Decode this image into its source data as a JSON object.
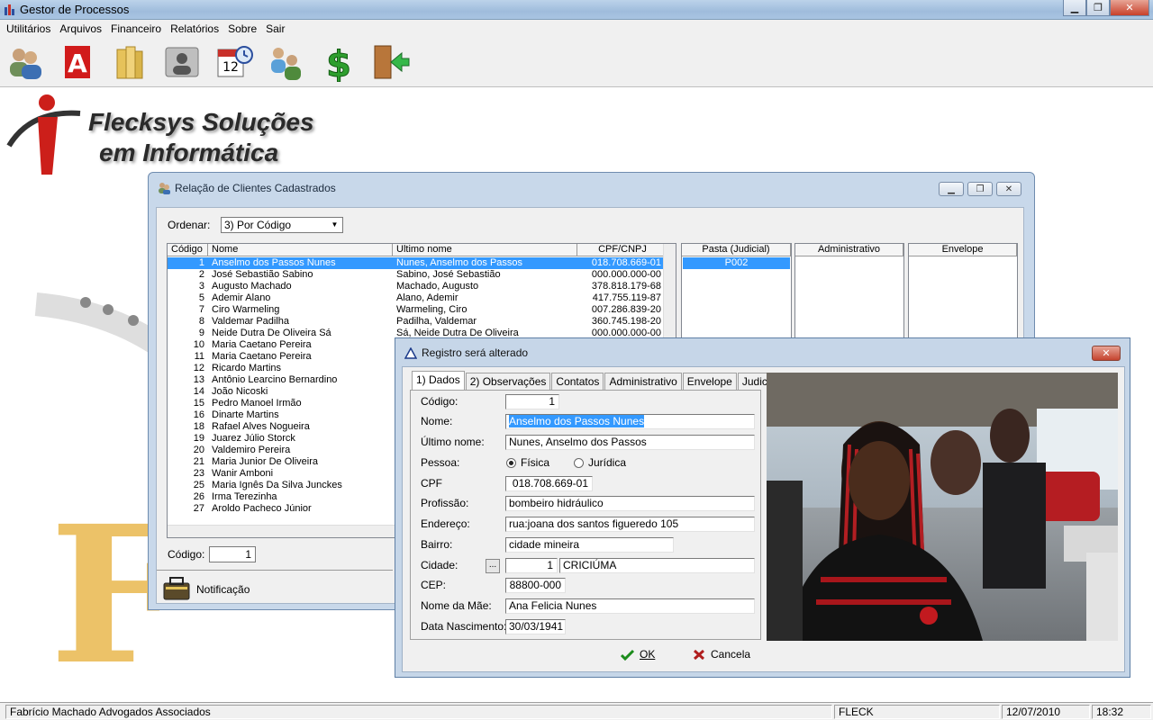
{
  "window": {
    "title": "Gestor de Processos"
  },
  "menu": [
    "Utilitários",
    "Arquivos",
    "Financeiro",
    "Relatórios",
    "Sobre",
    "Sair"
  ],
  "toolbar_icons": [
    "clients-icon",
    "acrobat-icon",
    "folders-icon",
    "contact-card-icon",
    "calendar-clock-icon",
    "users-icon",
    "dollar-icon",
    "exit-door-icon"
  ],
  "logo": {
    "line1": "Flecksys Soluções",
    "line2": "em Informática"
  },
  "clients": {
    "title": "Relação de Clientes Cadastrados",
    "order_label": "Ordenar:",
    "order_value": "3) Por Código",
    "columns": [
      "Código",
      "Nome",
      "Ultimo nome",
      "CPF/CNPJ"
    ],
    "rows": [
      [
        "1",
        "Anselmo dos Passos Nunes",
        "Nunes,  Anselmo dos Passos",
        "018.708.669-01"
      ],
      [
        "2",
        "José Sebastião Sabino",
        "Sabino,  José Sebastião",
        "000.000.000-00"
      ],
      [
        "3",
        "Augusto Machado",
        "Machado,  Augusto",
        "378.818.179-68"
      ],
      [
        "5",
        "Ademir Alano",
        "Alano,  Ademir",
        "417.755.119-87"
      ],
      [
        "7",
        "Ciro Warmeling",
        "Warmeling,  Ciro",
        "007.286.839-20"
      ],
      [
        "8",
        "Valdemar Padilha",
        "Padilha,  Valdemar",
        "360.745.198-20"
      ],
      [
        "9",
        "Neide Dutra De Oliveira Sá",
        "Sá,  Neide Dutra De Oliveira",
        "000.000.000-00"
      ],
      [
        "10",
        "Maria Caetano Pereira",
        "",
        ""
      ],
      [
        "11",
        "Maria Caetano Pereira",
        "",
        ""
      ],
      [
        "12",
        "Ricardo Martins",
        "",
        ""
      ],
      [
        "13",
        "Antônio Learcino Bernardino",
        "",
        ""
      ],
      [
        "14",
        "João Nicoski",
        "",
        ""
      ],
      [
        "15",
        "Pedro Manoel Irmão",
        "",
        ""
      ],
      [
        "16",
        "Dinarte Martins",
        "",
        ""
      ],
      [
        "18",
        "Rafael Alves Nogueira",
        "",
        ""
      ],
      [
        "19",
        "Juarez Júlio Storck",
        "",
        ""
      ],
      [
        "20",
        "Valdemiro Pereira",
        "",
        ""
      ],
      [
        "21",
        "Maria Junior De Oliveira",
        "",
        ""
      ],
      [
        "23",
        "Wanir Amboni",
        "",
        ""
      ],
      [
        "25",
        "Maria Ignês Da Silva Junckes",
        "",
        ""
      ],
      [
        "26",
        "Irma Terezinha",
        "",
        ""
      ],
      [
        "27",
        "Aroldo Pacheco Júnior",
        "",
        ""
      ]
    ],
    "side_columns": [
      "Pasta (Judicial)",
      "Administrativo",
      "Envelope"
    ],
    "pasta_value": "P002",
    "code_label": "Código:",
    "code_value": "1",
    "notification": "Notificação"
  },
  "dialog": {
    "title": "Registro será alterado",
    "tabs": [
      "1) Dados",
      "2) Observações",
      "Contatos",
      "Administrativo",
      "Envelope",
      "Judicial"
    ],
    "fields": {
      "codigo_label": "Código:",
      "codigo": "1",
      "nome_label": "Nome:",
      "nome": "Anselmo dos Passos Nunes",
      "ultimo_label": "Último nome:",
      "ultimo": "Nunes,  Anselmo dos Passos",
      "pessoa_label": "Pessoa:",
      "fisica": "Física",
      "juridica": "Jurídica",
      "cpf_label": "CPF",
      "cpf": "018.708.669-01",
      "profissao_label": "Profissão:",
      "profissao": "bombeiro hidráulico",
      "endereco_label": "Endereço:",
      "endereco": "rua:joana dos santos figueredo 105",
      "bairro_label": "Bairro:",
      "bairro": "cidade mineira",
      "cidade_label": "Cidade:",
      "cidade_code": "1",
      "cidade": "CRICIÚMA",
      "cep_label": "CEP:",
      "cep": "88800-000",
      "mae_label": "Nome da Mãe:",
      "mae": "Ana Felicia Nunes",
      "nasc_label": "Data Nascimento:",
      "nasc": "30/03/1941"
    },
    "ok": "OK",
    "cancel": "Cancela"
  },
  "status": {
    "company": "Fabrício Machado Advogados Associados",
    "user": "FLECK",
    "date": "12/07/2010",
    "time": "18:32"
  },
  "colors": {
    "selection": "#3399ff",
    "dialog_frame": "#c6d6e8",
    "accent_red": "#c5432e"
  }
}
